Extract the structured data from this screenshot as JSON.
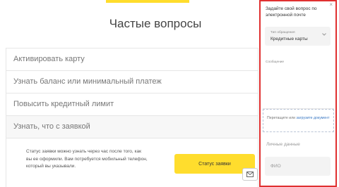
{
  "page": {
    "title": "Частые вопросы"
  },
  "faq": {
    "items": [
      {
        "label": "Активировать карту"
      },
      {
        "label": "Узнать баланс или минимальный платеж"
      },
      {
        "label": "Повысить кредитный лимит"
      },
      {
        "label": "Узнать, что с заявкой"
      }
    ],
    "open_answer": "Статус заявки можно узнать через час после того, как вы ее оформили. Вам потребуется мобильный телефон, который вы указывали.",
    "status_button_label": "Статус заявки"
  },
  "feedback_panel": {
    "close_glyph": "×",
    "title": "Задайте свой вопрос по электронной почте",
    "topic_label": "Тип обращения",
    "topic_value": "Кредитные карты",
    "message_label": "Сообщение",
    "dropzone_text": "Перетащите или",
    "dropzone_link": "загрузите документ",
    "personal_label": "Личные данные",
    "name_placeholder": "ФИО"
  },
  "colors": {
    "accent": "#ffdd2d",
    "highlight_border": "#e03030",
    "link": "#3a78c3"
  },
  "icons": {
    "mail": "mail-icon",
    "chevron": "chevron-down-icon"
  }
}
